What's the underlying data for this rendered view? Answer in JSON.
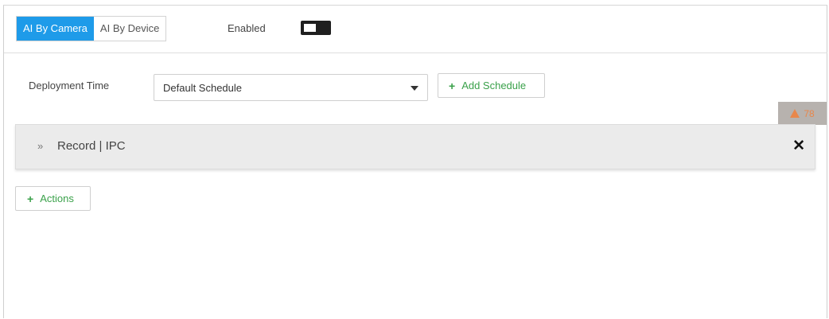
{
  "tabs": [
    {
      "label": "AI By Camera",
      "active": true
    },
    {
      "label": "AI By Device",
      "active": false
    }
  ],
  "enabled": {
    "label": "Enabled",
    "state": "off"
  },
  "deployment": {
    "label": "Deployment Time",
    "selected": "Default Schedule",
    "add_schedule_label": "Add Schedule"
  },
  "alert_badge": {
    "count": "78"
  },
  "action_panel": {
    "title": "Record | IPC",
    "expand_glyph": "»",
    "close_glyph": "✕"
  },
  "actions_button": {
    "label": "Actions"
  },
  "colors": {
    "accent": "#1e9be9",
    "green": "#3aa14a",
    "warning": "#e8874b"
  }
}
